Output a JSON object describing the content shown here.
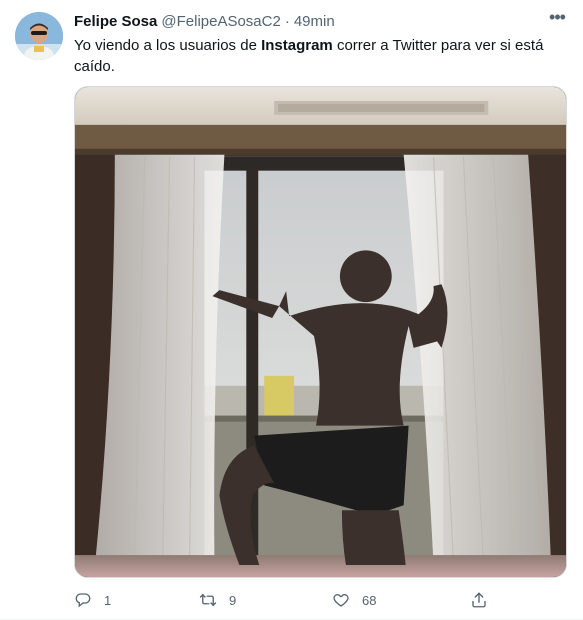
{
  "tweet": {
    "display_name": "Felipe Sosa",
    "handle": "@FelipeASosaC2",
    "separator": "·",
    "time": "49min",
    "more_icon": "more-horizontal-icon",
    "text_before": "Yo viendo a los usuarios de ",
    "text_bold": "Instagram",
    "text_after": " correr a Twitter para ver si está caído.",
    "media_alt": "Photo: man in boxer shorts opening curtains in front of a window"
  },
  "actions": {
    "reply_icon": "reply-icon",
    "reply_count": "1",
    "retweet_icon": "retweet-icon",
    "retweet_count": "9",
    "like_icon": "heart-icon",
    "like_count": "68",
    "share_icon": "share-icon"
  },
  "colors": {
    "text_primary": "#0f1419",
    "text_secondary": "#536471",
    "border": "#cfd9de"
  }
}
